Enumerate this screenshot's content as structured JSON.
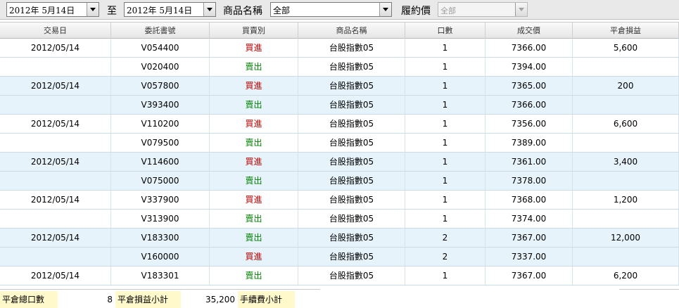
{
  "filters": {
    "date_from": "2012年  5月14日",
    "date_separator": "至",
    "date_to": "2012年  5月14日",
    "product_label": "商品名稱",
    "product_value": "全部",
    "strike_label": "履約價",
    "strike_value": "全部"
  },
  "table": {
    "columns": [
      "交易日",
      "委託書號",
      "買賣別",
      "商品名稱",
      "口數",
      "成交價",
      "平倉損益"
    ],
    "rows": [
      {
        "date": "2012/05/14",
        "order": "V054400",
        "side": "買進",
        "side_type": "buy",
        "product": "台股指數05",
        "qty": "1",
        "price": "7366.00",
        "pnl": "5,600"
      },
      {
        "date": "",
        "order": "V020400",
        "side": "賣出",
        "side_type": "sell",
        "product": "台股指數05",
        "qty": "1",
        "price": "7394.00",
        "pnl": ""
      },
      {
        "date": "2012/05/14",
        "order": "V057800",
        "side": "買進",
        "side_type": "buy",
        "product": "台股指數05",
        "qty": "1",
        "price": "7365.00",
        "pnl": "200"
      },
      {
        "date": "",
        "order": "V393400",
        "side": "賣出",
        "side_type": "sell",
        "product": "台股指數05",
        "qty": "1",
        "price": "7366.00",
        "pnl": ""
      },
      {
        "date": "2012/05/14",
        "order": "V110200",
        "side": "買進",
        "side_type": "buy",
        "product": "台股指數05",
        "qty": "1",
        "price": "7356.00",
        "pnl": "6,600"
      },
      {
        "date": "",
        "order": "V079500",
        "side": "賣出",
        "side_type": "sell",
        "product": "台股指數05",
        "qty": "1",
        "price": "7389.00",
        "pnl": ""
      },
      {
        "date": "2012/05/14",
        "order": "V114600",
        "side": "買進",
        "side_type": "buy",
        "product": "台股指數05",
        "qty": "1",
        "price": "7361.00",
        "pnl": "3,400"
      },
      {
        "date": "",
        "order": "V075000",
        "side": "賣出",
        "side_type": "sell",
        "product": "台股指數05",
        "qty": "1",
        "price": "7378.00",
        "pnl": ""
      },
      {
        "date": "2012/05/14",
        "order": "V337900",
        "side": "買進",
        "side_type": "buy",
        "product": "台股指數05",
        "qty": "1",
        "price": "7368.00",
        "pnl": "1,200"
      },
      {
        "date": "",
        "order": "V313900",
        "side": "賣出",
        "side_type": "sell",
        "product": "台股指數05",
        "qty": "1",
        "price": "7374.00",
        "pnl": ""
      },
      {
        "date": "2012/05/14",
        "order": "V183300",
        "side": "賣出",
        "side_type": "sell",
        "product": "台股指數05",
        "qty": "2",
        "price": "7367.00",
        "pnl": "12,000"
      },
      {
        "date": "",
        "order": "V160000",
        "side": "買進",
        "side_type": "buy",
        "product": "台股指數05",
        "qty": "2",
        "price": "7337.00",
        "pnl": ""
      },
      {
        "date": "2012/05/14",
        "order": "V183301",
        "side": "賣出",
        "side_type": "sell",
        "product": "台股指數05",
        "qty": "1",
        "price": "7367.00",
        "pnl": "6,200"
      }
    ]
  },
  "footer": {
    "total_qty_label": "平倉總口數",
    "total_qty": "8",
    "pnl_subtotal_label": "平倉損益小計",
    "pnl_subtotal": "35,200",
    "fee_subtotal_label": "手續費小計"
  },
  "colors": {
    "buy": "#c00000",
    "sell": "#008000",
    "row_alt": "#e6f3fa",
    "footer_label_bg": "#fff9cc"
  }
}
